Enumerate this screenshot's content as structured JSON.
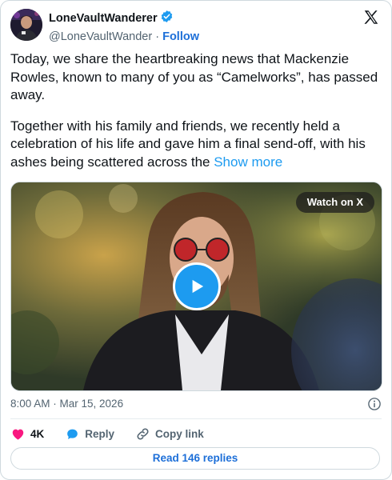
{
  "author": {
    "display_name": "LoneVaultWanderer",
    "handle": "@LoneVaultWander",
    "separator": "·",
    "follow_label": "Follow",
    "verified_color": "#1d9bf0"
  },
  "tweet": {
    "paragraph1": "Today, we share the heartbreaking news that Mackenzie Rowles, known to many of you as “Camelworks”, has passed away.",
    "paragraph2": "Together with his family and friends, we recently held a celebration of his life and gave him a final send-off, with his ashes being scattered across the",
    "show_more_label": "Show more"
  },
  "media": {
    "watch_label": "Watch on X",
    "play_icon": "play-icon"
  },
  "meta": {
    "timestamp": "8:00 AM · Mar 15, 2026",
    "info_icon": "info-icon"
  },
  "actions": {
    "likes": "4K",
    "reply_label": "Reply",
    "copy_label": "Copy link"
  },
  "replies": {
    "label": "Read 146 replies"
  },
  "colors": {
    "accent": "#1d9bf0",
    "link": "#1d6fd8",
    "like": "#f91880"
  }
}
